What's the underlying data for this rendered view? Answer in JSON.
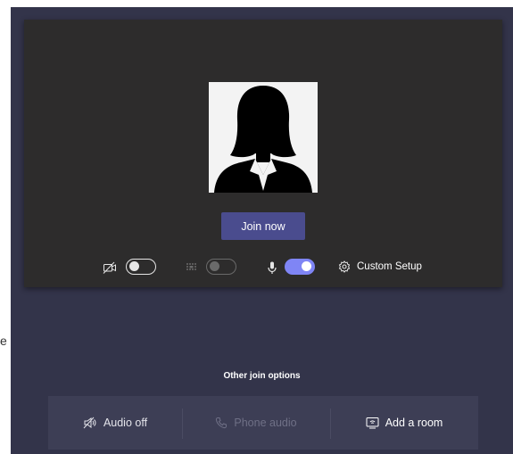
{
  "edge_text": "e",
  "preview": {
    "join_button_label": "Join now",
    "controls": {
      "camera": {
        "state": "off",
        "icon": "camera-off-icon"
      },
      "background": {
        "state": "off",
        "disabled": true,
        "icon": "background-blur-icon"
      },
      "microphone": {
        "state": "on",
        "icon": "microphone-icon"
      },
      "custom_setup_label": "Custom Setup"
    }
  },
  "other_options": {
    "title": "Other join options",
    "items": [
      {
        "label": "Audio off",
        "icon": "speaker-off-icon",
        "enabled": true
      },
      {
        "label": "Phone audio",
        "icon": "phone-icon",
        "enabled": false
      },
      {
        "label": "Add a room",
        "icon": "cast-room-icon",
        "enabled": true
      }
    ]
  },
  "colors": {
    "app_background": "#33344a",
    "preview_background": "#2d2c2c",
    "accent": "#7f85f5",
    "join_button": "#4a4c8e"
  }
}
